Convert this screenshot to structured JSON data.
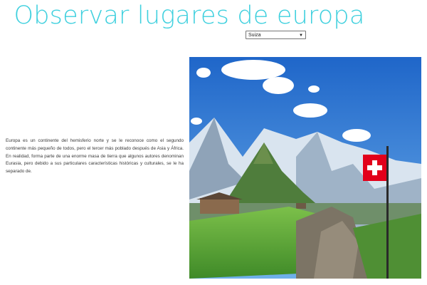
{
  "header": {
    "title": "Observar lugares de europa"
  },
  "country_select": {
    "value": "Suiza",
    "icon": "chevron-down-icon"
  },
  "description": "Europa es un continente del hemisferio norte y se le reconoce como el segundo continente más pequeño de todos, pero el tercer más poblado después de Asia y África. En realidad, forma parte de una enorme masa de tierra que algunos autores denominan Eurasia, pero debido a sus particulares características históricas y culturales, se le ha separado de.",
  "image": {
    "subject": "swiss-alps-with-flag",
    "flag_colors": [
      "#e2001a",
      "#ffffff"
    ]
  },
  "colors": {
    "title": "#3fd0de",
    "sky": "#2f7fd6",
    "grass": "#5ea53a"
  }
}
